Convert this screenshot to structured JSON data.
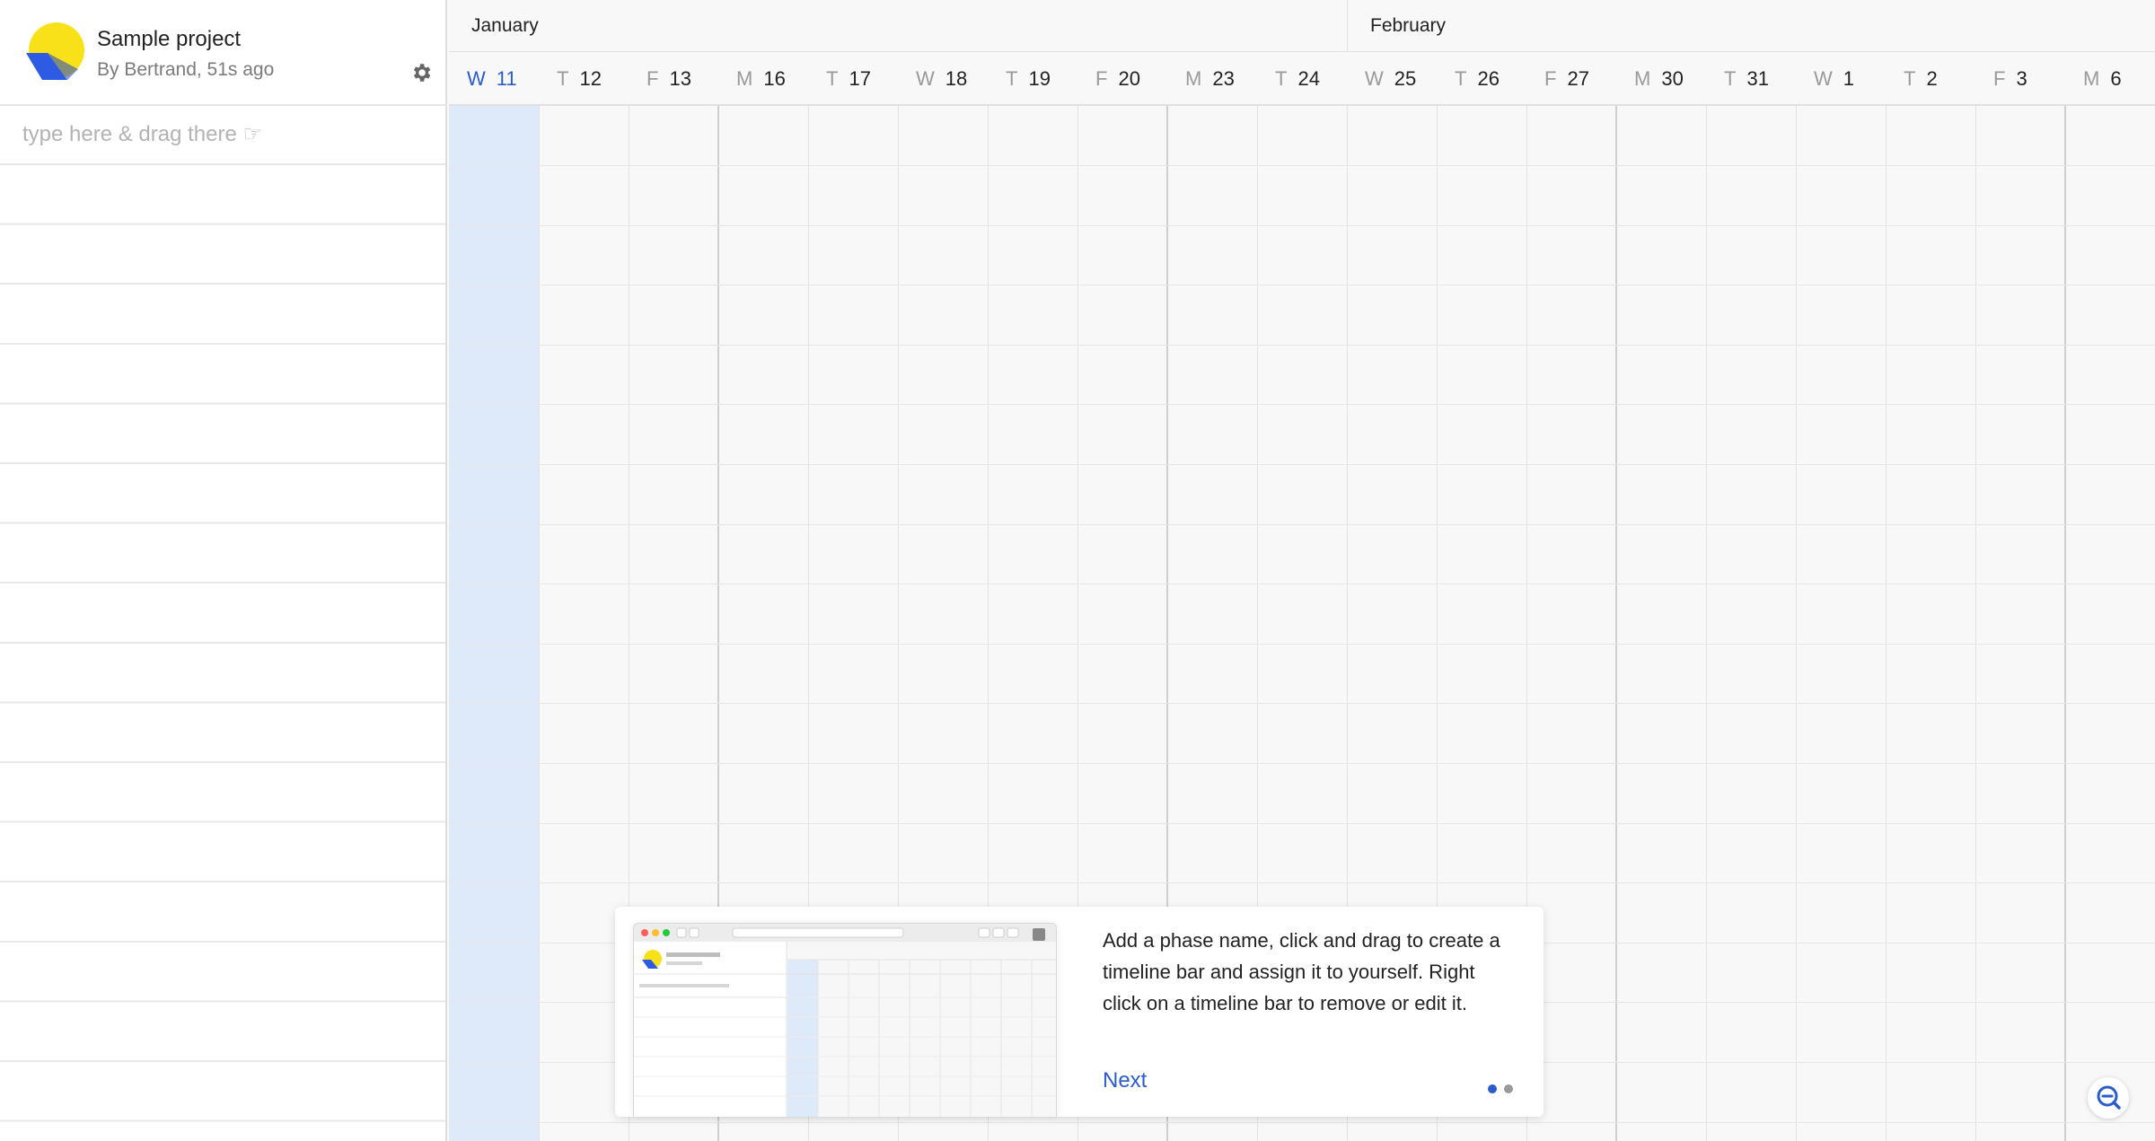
{
  "project": {
    "title": "Sample project",
    "subtitle": "By Bertrand, 51s ago"
  },
  "task_input": {
    "placeholder": "type here & drag there ☞",
    "value": ""
  },
  "months": [
    {
      "label": "January"
    },
    {
      "label": "February"
    }
  ],
  "days": [
    {
      "letter": "W",
      "num": "11",
      "today": true
    },
    {
      "letter": "T",
      "num": "12"
    },
    {
      "letter": "F",
      "num": "13"
    },
    {
      "letter": "M",
      "num": "16"
    },
    {
      "letter": "T",
      "num": "17"
    },
    {
      "letter": "W",
      "num": "18"
    },
    {
      "letter": "T",
      "num": "19"
    },
    {
      "letter": "F",
      "num": "20"
    },
    {
      "letter": "M",
      "num": "23"
    },
    {
      "letter": "T",
      "num": "24"
    },
    {
      "letter": "W",
      "num": "25"
    },
    {
      "letter": "T",
      "num": "26"
    },
    {
      "letter": "F",
      "num": "27"
    },
    {
      "letter": "M",
      "num": "30"
    },
    {
      "letter": "T",
      "num": "31"
    },
    {
      "letter": "W",
      "num": "1"
    },
    {
      "letter": "T",
      "num": "2"
    },
    {
      "letter": "F",
      "num": "3"
    },
    {
      "letter": "M",
      "num": "6"
    }
  ],
  "onboarding": {
    "text": "Add a phase name, click and drag to create a timeline bar and assign it to yourself. Right click on a timeline bar to remove or edit it.",
    "next_label": "Next",
    "step": 1,
    "total_steps": 2
  },
  "icons": {
    "settings": "gear-icon",
    "zoom": "zoom-out-icon",
    "logo": "app-logo"
  },
  "colors": {
    "accent": "#2a5dc9",
    "today_column": "#dee9fa",
    "logo_yellow": "#f9e11a",
    "logo_blue": "#2d5be3"
  }
}
